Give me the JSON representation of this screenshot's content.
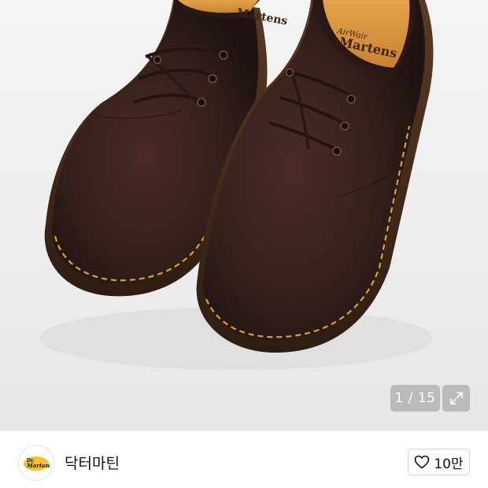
{
  "gallery": {
    "counter": "1 / 15",
    "expand_icon": "expand-icon",
    "insole_brand_top": "AirWair",
    "insole_brand_main": "Dr. Martens"
  },
  "brand": {
    "logo_text": "Dr. Martens",
    "name": "닥터마틴"
  },
  "like": {
    "icon": "heart-icon",
    "count": "10만"
  },
  "colors": {
    "leather": "#3a1f1a",
    "welt_stitch": "#d9a531",
    "overlay": "#969696"
  }
}
